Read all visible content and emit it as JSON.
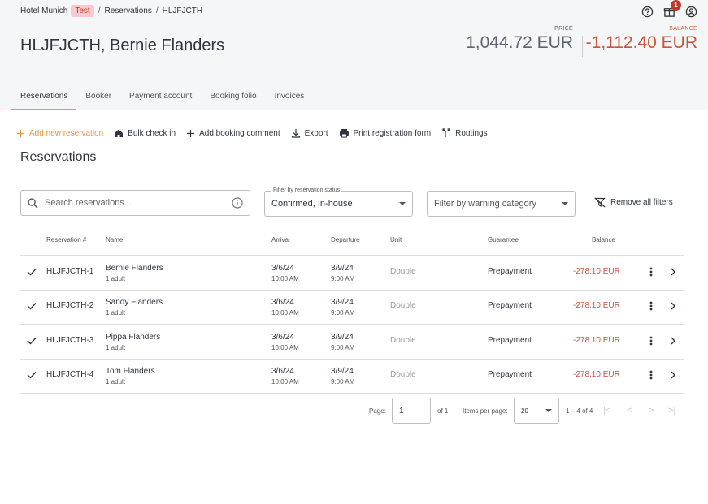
{
  "breadcrumb": {
    "hotel": "Hotel Munich",
    "env": "Test",
    "section": "Reservations",
    "booking": "HLJFJCTH"
  },
  "header": {
    "title": "HLJFJCTH, Bernie Flanders",
    "price_label": "PRICE",
    "price_value": "1,044.72 EUR",
    "balance_label": "BALANCE",
    "balance_value": "-1,112.40 EUR",
    "notifications": "1"
  },
  "tabs": [
    "Reservations",
    "Booker",
    "Payment account",
    "Booking folio",
    "Invoices"
  ],
  "toolbar": {
    "add_reservation": "Add new reservation",
    "bulk_check_in": "Bulk check in",
    "add_comment": "Add booking comment",
    "export": "Export",
    "print_form": "Print registration form",
    "routings": "Routings"
  },
  "section_title": "Reservations",
  "filters": {
    "search_placeholder": "Search reservations...",
    "status_label": "Filter by reservation status",
    "status_value": "Confirmed, In-house",
    "warning_placeholder": "Filter by warning category",
    "remove_all": "Remove all filters"
  },
  "table": {
    "headers": {
      "number": "Reservation #",
      "name": "Name",
      "arrival": "Arrival",
      "departure": "Departure",
      "unit": "Unit",
      "guarantee": "Guarantee",
      "balance": "Balance"
    },
    "rows": [
      {
        "number": "HLJFJCTH-1",
        "name": "Bernie Flanders",
        "guests": "1 adult",
        "arrival_date": "3/6/24",
        "arrival_time": "10:00 AM",
        "departure_date": "3/9/24",
        "departure_time": "9:00 AM",
        "unit": "Double",
        "guarantee": "Prepayment",
        "balance": "-278.10 EUR"
      },
      {
        "number": "HLJFJCTH-2",
        "name": "Sandy Flanders",
        "guests": "1 adult",
        "arrival_date": "3/6/24",
        "arrival_time": "10:00 AM",
        "departure_date": "3/9/24",
        "departure_time": "9:00 AM",
        "unit": "Double",
        "guarantee": "Prepayment",
        "balance": "-278.10 EUR"
      },
      {
        "number": "HLJFJCTH-3",
        "name": "Pippa Flanders",
        "guests": "1 adult",
        "arrival_date": "3/6/24",
        "arrival_time": "10:00 AM",
        "departure_date": "3/9/24",
        "departure_time": "9:00 AM",
        "unit": "Double",
        "guarantee": "Prepayment",
        "balance": "-278.10 EUR"
      },
      {
        "number": "HLJFJCTH-4",
        "name": "Tom Flanders",
        "guests": "1 adult",
        "arrival_date": "3/6/24",
        "arrival_time": "10:00 AM",
        "departure_date": "3/9/24",
        "departure_time": "9:00 AM",
        "unit": "Double",
        "guarantee": "Prepayment",
        "balance": "-278.10 EUR"
      }
    ]
  },
  "pagination": {
    "page_label": "Page:",
    "page": "1",
    "of": "of 1",
    "items_label": "Items per page:",
    "items": "20",
    "range": "1 – 4 of 4"
  },
  "colors": {
    "accent": "#e7973a",
    "negative": "#c8553d",
    "env_badge_bg": "#f9c9ce"
  }
}
